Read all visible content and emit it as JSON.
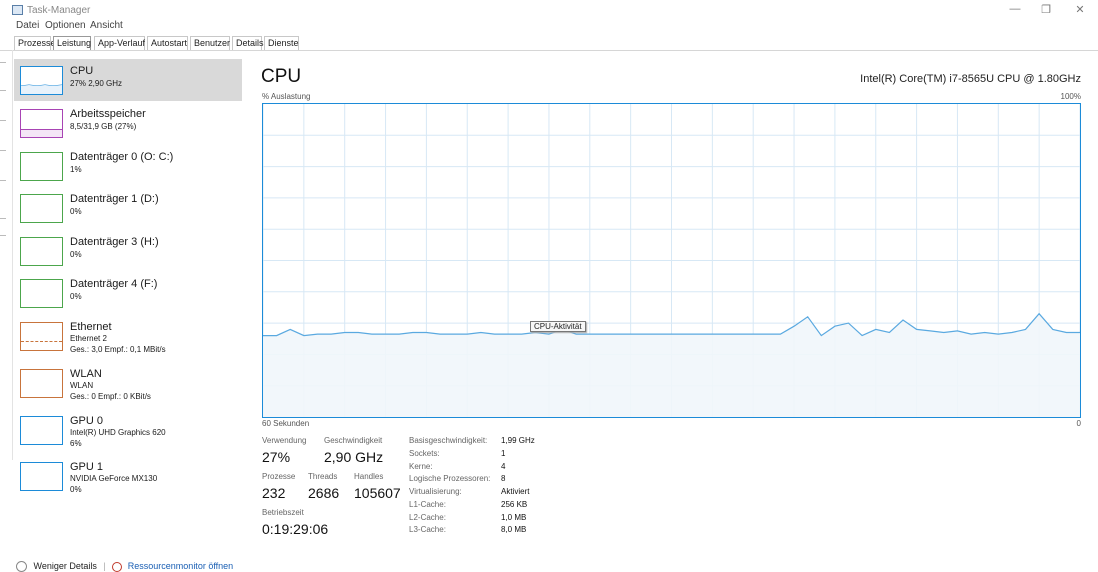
{
  "window": {
    "title": "Task-Manager",
    "controls": [
      "—",
      "❐",
      "✕"
    ]
  },
  "menu": [
    "Datei",
    "Optionen",
    "Ansicht"
  ],
  "tabs": [
    {
      "label": "Prozesse",
      "active": false
    },
    {
      "label": "Leistung",
      "active": true
    },
    {
      "label": "App-Verlauf",
      "active": false
    },
    {
      "label": "Autostart",
      "active": false
    },
    {
      "label": "Benutzer",
      "active": false
    },
    {
      "label": "Details",
      "active": false
    },
    {
      "label": "Dienste",
      "active": false
    }
  ],
  "sidebar": {
    "items": [
      {
        "title": "CPU",
        "sub1": "27% 2,90 GHz",
        "sub2": "",
        "color": "#1c8bd8",
        "active": true
      },
      {
        "title": "Arbeitsspeicher",
        "sub1": "8,5/31,9 GB (27%)",
        "sub2": "",
        "color": "#a844b4",
        "active": false
      },
      {
        "title": "Datenträger 0 (O: C:)",
        "sub1": "1%",
        "sub2": "",
        "color": "#4ca64c",
        "active": false
      },
      {
        "title": "Datenträger 1 (D:)",
        "sub1": "0%",
        "sub2": "",
        "color": "#4ca64c",
        "active": false
      },
      {
        "title": "Datenträger 3 (H:)",
        "sub1": "0%",
        "sub2": "",
        "color": "#4ca64c",
        "active": false
      },
      {
        "title": "Datenträger 4 (F:)",
        "sub1": "0%",
        "sub2": "",
        "color": "#4ca64c",
        "active": false
      },
      {
        "title": "Ethernet",
        "sub1": "Ethernet 2",
        "sub2": "Ges.: 3,0 Empf.: 0,1 MBit/s",
        "color": "#c8743c",
        "active": false
      },
      {
        "title": "WLAN",
        "sub1": "WLAN",
        "sub2": "Ges.: 0 Empf.: 0 KBit/s",
        "color": "#c8743c",
        "active": false
      },
      {
        "title": "GPU 0",
        "sub1": "Intel(R) UHD Graphics 620",
        "sub2": "6%",
        "color": "#1c8bd8",
        "active": false
      },
      {
        "title": "GPU 1",
        "sub1": "NVIDIA GeForce MX130",
        "sub2": "0%",
        "color": "#1c8bd8",
        "active": false
      }
    ]
  },
  "main": {
    "title": "CPU",
    "cpu_model": "Intel(R) Core(TM) i7-8565U CPU @ 1.80GHz",
    "y_label": "% Auslastung",
    "y_max_label": "100%",
    "x_label": "60 Sekunden",
    "x_end_label": "0",
    "tooltip": "CPU-Aktivität",
    "stats": {
      "verwendung_label": "Verwendung",
      "verwendung_value": "27%",
      "geschwindigkeit_label": "Geschwindigkeit",
      "geschwindigkeit_value": "2,90 GHz",
      "prozesse_label": "Prozesse",
      "prozesse_value": "232",
      "threads_label": "Threads",
      "threads_value": "2686",
      "handles_label": "Handles",
      "handles_value": "105607",
      "betriebszeit_label": "Betriebszeit",
      "betriebszeit_value": "0:19:29:06"
    },
    "info": [
      {
        "label": "Basisgeschwindigkeit:",
        "value": "1,99 GHz"
      },
      {
        "label": "Sockets:",
        "value": "1"
      },
      {
        "label": "Kerne:",
        "value": "4"
      },
      {
        "label": "Logische Prozessoren:",
        "value": "8"
      },
      {
        "label": "Virtualisierung:",
        "value": "Aktiviert"
      },
      {
        "label": "L1-Cache:",
        "value": "256 KB"
      },
      {
        "label": "L2-Cache:",
        "value": "1,0 MB"
      },
      {
        "label": "L3-Cache:",
        "value": "8,0 MB"
      }
    ]
  },
  "footer": {
    "fewer_details": "Weniger Details",
    "resource_monitor": "Ressourcenmonitor öffnen"
  },
  "chart_data": {
    "type": "area",
    "title": "CPU",
    "xlabel": "60 Sekunden",
    "ylabel": "% Auslastung",
    "xlim": [
      60,
      0
    ],
    "ylim": [
      0,
      100
    ],
    "grid": true,
    "x": [
      60,
      59,
      58,
      57,
      56,
      55,
      54,
      53,
      52,
      51,
      50,
      49,
      48,
      47,
      46,
      45,
      44,
      43,
      42,
      41,
      40,
      39,
      38,
      37,
      36,
      35,
      34,
      33,
      32,
      31,
      30,
      29,
      28,
      27,
      26,
      25,
      24,
      23,
      22,
      21,
      20,
      19,
      18,
      17,
      16,
      15,
      14,
      13,
      12,
      11,
      10,
      9,
      8,
      7,
      6,
      5,
      4,
      3,
      2,
      1,
      0
    ],
    "values": [
      26,
      26,
      28,
      26,
      26.5,
      26.5,
      27,
      27,
      26.5,
      26.5,
      26.5,
      27,
      27,
      26.5,
      26.5,
      26.5,
      27,
      26.5,
      26.5,
      26.5,
      27,
      26.5,
      28,
      26.5,
      26.5,
      26.5,
      26.5,
      26.5,
      26.5,
      26.5,
      26.5,
      26.5,
      26.5,
      26.5,
      26.5,
      26.5,
      26.5,
      26.5,
      26.5,
      29,
      32,
      26,
      29,
      30,
      26,
      28,
      27,
      31,
      28,
      27.5,
      27,
      27.5,
      26.5,
      27,
      26.5,
      27,
      28,
      33,
      28,
      27,
      27
    ]
  }
}
